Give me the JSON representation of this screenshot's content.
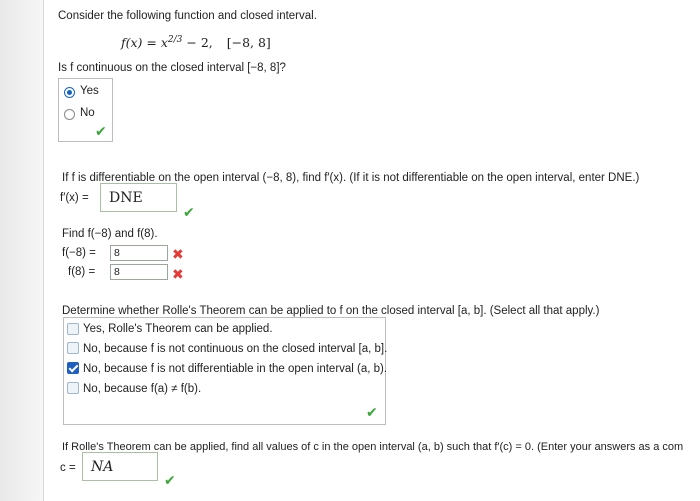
{
  "q1": {
    "prompt": "Consider the following function and closed interval.",
    "function": "f(x) = x^(2/3) − 2,",
    "function_base": "f(x) = x",
    "function_exp": "2/3",
    "function_tail": "− 2,",
    "interval": "[−8, 8]",
    "question": "Is f continuous on the closed interval [−8, 8]?",
    "options": [
      "Yes",
      "No"
    ],
    "selected": "Yes"
  },
  "q2": {
    "prompt": "If f is differentiable on the open interval (−8, 8), find f′(x). (If it is not differentiable on the open interval, enter DNE.)",
    "label": "f′(x) =",
    "value": "DNE"
  },
  "q3": {
    "prompt": "Find f(−8) and f(8).",
    "label_a": "f(−8) =",
    "value_a": "8",
    "label_b": "f(8) =",
    "value_b": "8"
  },
  "q4": {
    "prompt": "Determine whether Rolle's Theorem can be applied to f on the closed interval [a, b]. (Select all that apply.)",
    "options": [
      "Yes, Rolle's Theorem can be applied.",
      "No, because f is not continuous on the closed interval [a, b].",
      "No, because f is not differentiable in the open interval (a, b).",
      "No, because f(a) ≠ f(b)."
    ],
    "checked_index": 2
  },
  "q5": {
    "prompt": "If Rolle's Theorem can be applied, find all values of c in the open interval (a, b) such that f′(c) = 0. (Enter your answers as a com",
    "label": "c =",
    "value": "NA"
  },
  "colors": {
    "correct": "#3aa63a",
    "incorrect": "#e53935",
    "selected": "#1565c0"
  }
}
